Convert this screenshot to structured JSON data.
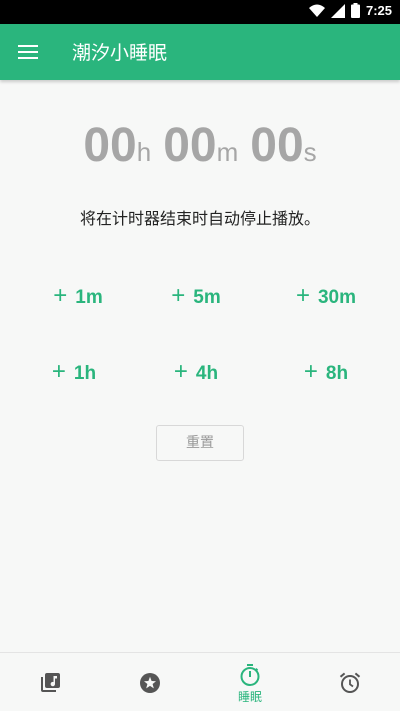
{
  "status_bar": {
    "time": "7:25"
  },
  "app_bar": {
    "title": "潮汐小睡眠"
  },
  "timer": {
    "hours": "00",
    "minutes": "00",
    "seconds": "00",
    "hours_unit": "h",
    "minutes_unit": "m",
    "seconds_unit": "s"
  },
  "message": "将在计时器结束时自动停止播放。",
  "add_buttons": [
    {
      "plus": "+",
      "label": "1m"
    },
    {
      "plus": "+",
      "label": "5m"
    },
    {
      "plus": "+",
      "label": "30m"
    },
    {
      "plus": "+",
      "label": "1h"
    },
    {
      "plus": "+",
      "label": "4h"
    },
    {
      "plus": "+",
      "label": "8h"
    }
  ],
  "reset_label": "重置",
  "bottom_nav": {
    "items": [
      {
        "icon": "music-library-icon"
      },
      {
        "icon": "star-icon"
      },
      {
        "icon": "timer-icon",
        "label": "睡眠",
        "active": true
      },
      {
        "icon": "alarm-icon"
      }
    ]
  },
  "colors": {
    "accent": "#2ab57d",
    "timer_text": "#a6a6a6",
    "inactive_icon": "#555555"
  }
}
